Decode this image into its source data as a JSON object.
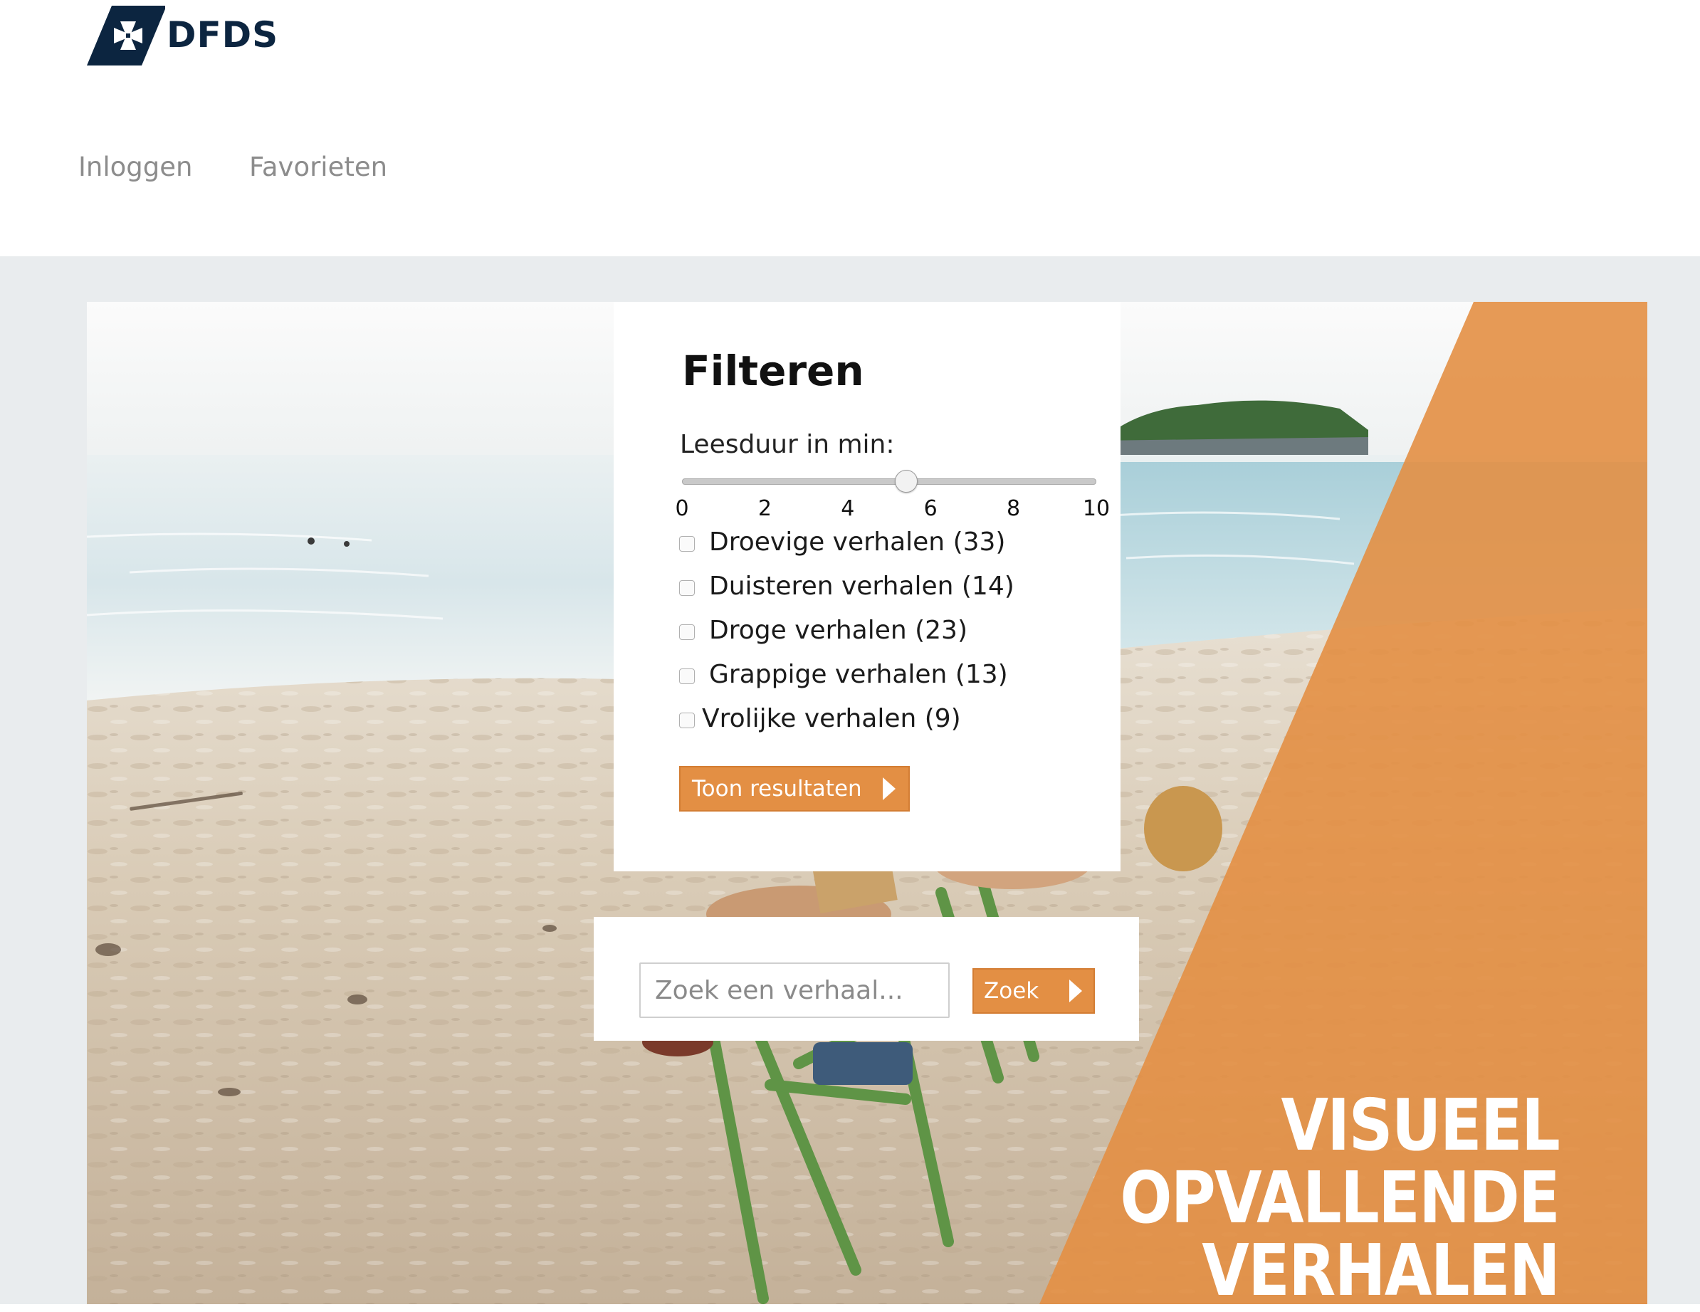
{
  "brand": {
    "name": "DFDS",
    "color_navy": "#0c2540",
    "logo_icon": "maltese-cross-icon"
  },
  "nav": {
    "login": "Inloggen",
    "favorites": "Favorieten"
  },
  "filter": {
    "title": "Filteren",
    "slider_label": "Leesduur in min:",
    "slider_min": 0,
    "slider_max": 10,
    "slider_value": 5.4,
    "ticks": [
      "0",
      "2",
      "4",
      "6",
      "8",
      "10"
    ],
    "categories": [
      {
        "label": "Droevige verhalen (33)",
        "checked": false
      },
      {
        "label": "Duisteren verhalen (14)",
        "checked": false
      },
      {
        "label": "Droge verhalen (23)",
        "checked": false
      },
      {
        "label": "Grappige verhalen (13)",
        "checked": false
      },
      {
        "label": "Vrolijke verhalen (9)",
        "checked": false
      }
    ],
    "submit_label": "Toon resultaten"
  },
  "search": {
    "placeholder": "Zoek een verhaal...",
    "value": "",
    "button_label": "Zoek"
  },
  "headline": {
    "line1": "VISUEEL",
    "line2": "OPVALLENDE",
    "line3": "VERHALEN"
  },
  "colors": {
    "accent_orange": "#e38f44",
    "page_bg": "#e9ecee",
    "card_bg": "#ffffff"
  }
}
